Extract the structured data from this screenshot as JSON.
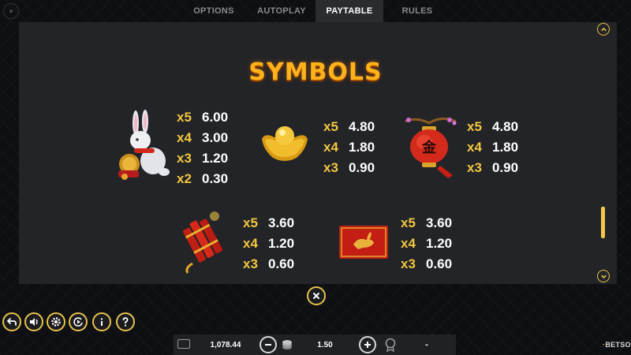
{
  "tabs": [
    {
      "label": "OPTIONS",
      "active": false
    },
    {
      "label": "AUTOPLAY",
      "active": false
    },
    {
      "label": "PAYTABLE",
      "active": true
    },
    {
      "label": "RULES",
      "active": false
    }
  ],
  "paytable": {
    "title": "SYMBOLS",
    "symbols": [
      {
        "icon": "rabbit-icon",
        "pays": [
          {
            "mult": "x5",
            "value": "6.00"
          },
          {
            "mult": "x4",
            "value": "3.00"
          },
          {
            "mult": "x3",
            "value": "1.20"
          },
          {
            "mult": "x2",
            "value": "0.30"
          }
        ]
      },
      {
        "icon": "gold-ingot-icon",
        "pays": [
          {
            "mult": "x5",
            "value": "4.80"
          },
          {
            "mult": "x4",
            "value": "1.80"
          },
          {
            "mult": "x3",
            "value": "0.90"
          }
        ]
      },
      {
        "icon": "lantern-icon",
        "pays": [
          {
            "mult": "x5",
            "value": "4.80"
          },
          {
            "mult": "x4",
            "value": "1.80"
          },
          {
            "mult": "x3",
            "value": "0.90"
          }
        ]
      },
      {
        "icon": "firecracker-icon",
        "pays": [
          {
            "mult": "x5",
            "value": "3.60"
          },
          {
            "mult": "x4",
            "value": "1.20"
          },
          {
            "mult": "x3",
            "value": "0.60"
          }
        ]
      },
      {
        "icon": "red-envelope-icon",
        "pays": [
          {
            "mult": "x5",
            "value": "3.60"
          },
          {
            "mult": "x4",
            "value": "1.20"
          },
          {
            "mult": "x3",
            "value": "0.60"
          }
        ]
      }
    ]
  },
  "scroll": {
    "position_fraction": 0.85
  },
  "controls": [
    "back-icon",
    "sound-icon",
    "settings-icon",
    "autoplay-icon",
    "info-icon",
    "help-icon"
  ],
  "bottom_bar": {
    "balance": "1,078.44",
    "bet": "1.50",
    "win": "-"
  },
  "brand": {
    "prefix": "BETSOFT",
    "accent": "·"
  },
  "colors": {
    "accent": "#e8c24a",
    "title": "#ffb21a",
    "multiplier": "#f2c640",
    "panel": "#232427"
  }
}
